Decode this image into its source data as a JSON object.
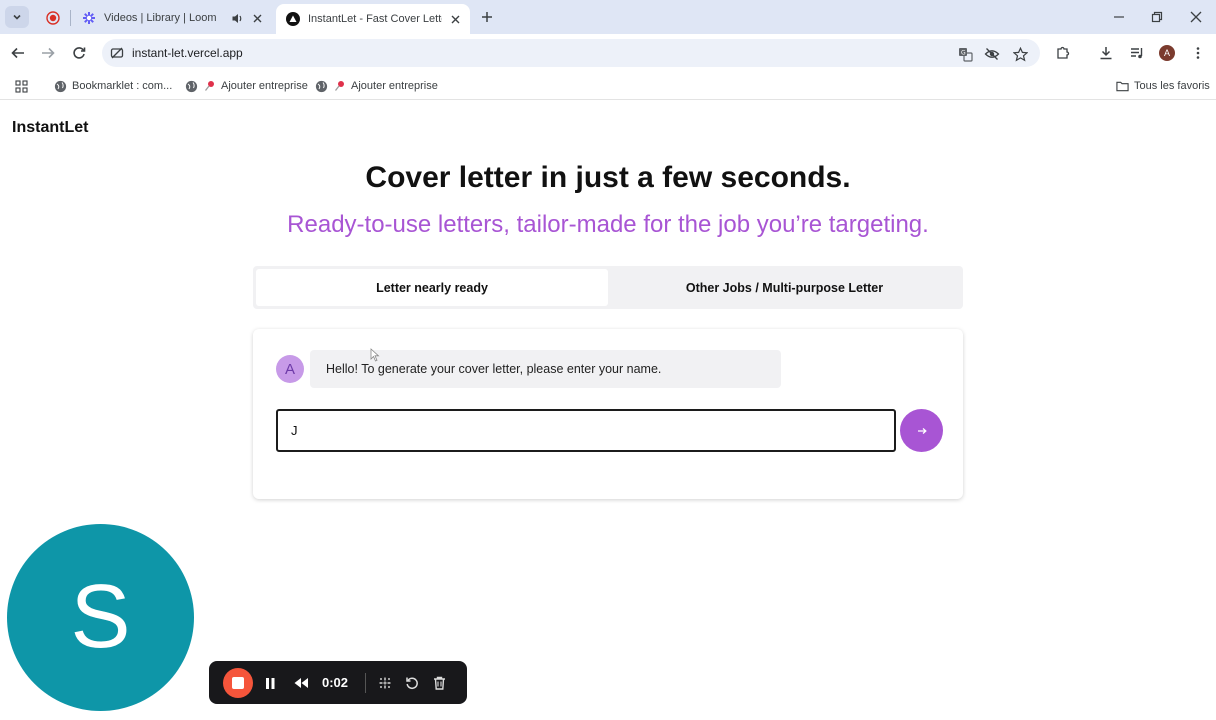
{
  "browser": {
    "tabs": [
      {
        "title": "",
        "icon": "recording-dot-icon"
      },
      {
        "title": "Videos | Library | Loom",
        "icon": "loom-icon",
        "audio": true
      },
      {
        "title": "InstantLet - Fast Cover Letter Ge",
        "icon": "instantlet-icon",
        "active": true
      }
    ],
    "url": "instant-let.vercel.app",
    "profile_initial": "A"
  },
  "bookmarks": {
    "items": [
      {
        "label": "Bookmarklet : com..."
      },
      {
        "label": "Ajouter entreprise"
      },
      {
        "label": "Ajouter entreprise"
      }
    ],
    "all_bookmarks": "Tous les favoris"
  },
  "page": {
    "brand": "InstantLet",
    "title": "Cover letter in just a few seconds.",
    "subtitle": "Ready-to-use letters, tailor-made for the job you’re targeting.",
    "tabs": [
      {
        "label": "Letter nearly ready",
        "active": true
      },
      {
        "label": "Other Jobs / Multi-purpose Letter",
        "active": false
      }
    ],
    "chat": {
      "avatar_initial": "A",
      "message": "Hello! To generate your cover letter, please enter your name.",
      "input_value": "J",
      "send_icon": "arrow-right-icon"
    },
    "accent_color": "#a855d4"
  },
  "loom": {
    "webcam_initial": "S",
    "timer": "0:02",
    "webcam_color": "#0e96a8",
    "stop_color": "#f5553b"
  }
}
